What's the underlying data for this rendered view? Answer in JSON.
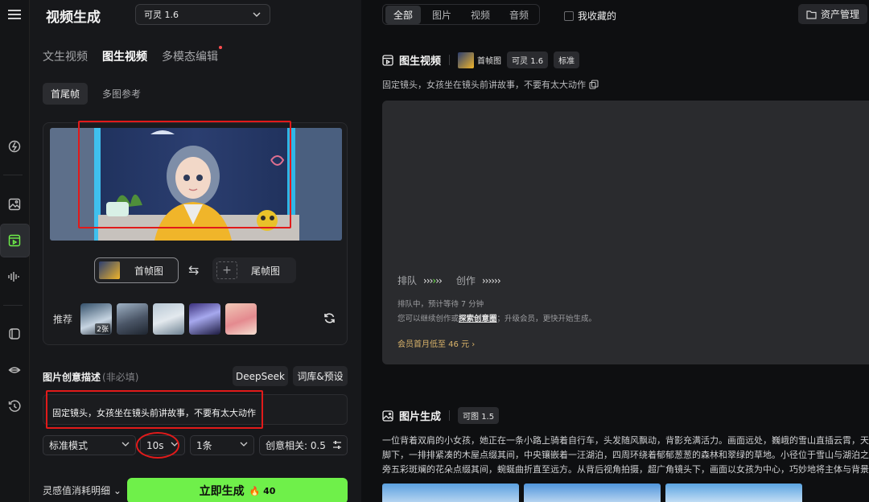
{
  "rail": {
    "icons": [
      "menu-icon",
      "lightning-icon",
      "image-icon",
      "video-icon",
      "audio-icon",
      "cube-icon",
      "lips-icon",
      "history-icon"
    ]
  },
  "panel": {
    "title": "视频生成",
    "model": "可灵 1.6",
    "tabs": [
      {
        "label": "文生视频"
      },
      {
        "label": "图生视频",
        "active": true
      },
      {
        "label": "多模态编辑"
      }
    ],
    "subtabs": [
      {
        "label": "首尾帧",
        "active": true
      },
      {
        "label": "多图参考"
      }
    ],
    "first_frame_label": "首帧图",
    "last_frame_label": "尾帧图",
    "recommend_label": "推荐",
    "recommend_badge": "2张",
    "desc_title": "图片创意描述",
    "desc_optional": "(非必填)",
    "deepseek_label": "DeepSeek",
    "preset_label": "词库&预设",
    "prompt_text": "固定镜头，女孩坐在镜头前讲故事，不要有太大动作",
    "mode": "标准模式",
    "duration": "10s",
    "count": "1条",
    "relevance": "创意相关: 0.5",
    "cost_label": "灵感值消耗明细",
    "generate_label": "立即生成",
    "generate_cost": "40"
  },
  "right": {
    "filters": [
      {
        "label": "全部",
        "active": true
      },
      {
        "label": "图片"
      },
      {
        "label": "视频"
      },
      {
        "label": "音频"
      }
    ],
    "favorites_label": "我收藏的",
    "asset_label": "资产管理",
    "video_section": {
      "title": "图生视频",
      "thumb_tag": "首帧图",
      "model_tag": "可灵 1.6",
      "quality_tag": "标准",
      "prompt": "固定镜头，女孩坐在镜头前讲故事，不要有太大动作",
      "queue_label": "排队",
      "create_label": "创作",
      "queue_status": "排队中，预计等待 7 分钟",
      "queue_hint_a": "您可以继续创作或",
      "queue_hint_link": "探索创意圈",
      "queue_hint_b": "；升级会员，更快开始生成。",
      "vip_text": "会员首月低至 46 元"
    },
    "image_section": {
      "title": "图片生成",
      "model_tag": "可图 1.5",
      "line1": "一位背着双肩的小女孩，她正在一条小路上骑着自行车，头发随风飘动，背影充满活力。画面远处，巍峨的雪山直插云霄，天空中漂",
      "line2": "脚下，一排排紧凑的木屋点缀其间，中央镶嵌着一汪湖泊，四周环绕着郁郁葱葱的森林和翠绿的草地。小径位于雪山与湖泊之间，右",
      "line3": "旁五彩斑斓的花朵点缀其间，蜿蜒曲折直至远方。从背后视角拍摄，超广角镜头下，画面以女孩为中心，巧妙地将主体与背景融为一"
    }
  }
}
